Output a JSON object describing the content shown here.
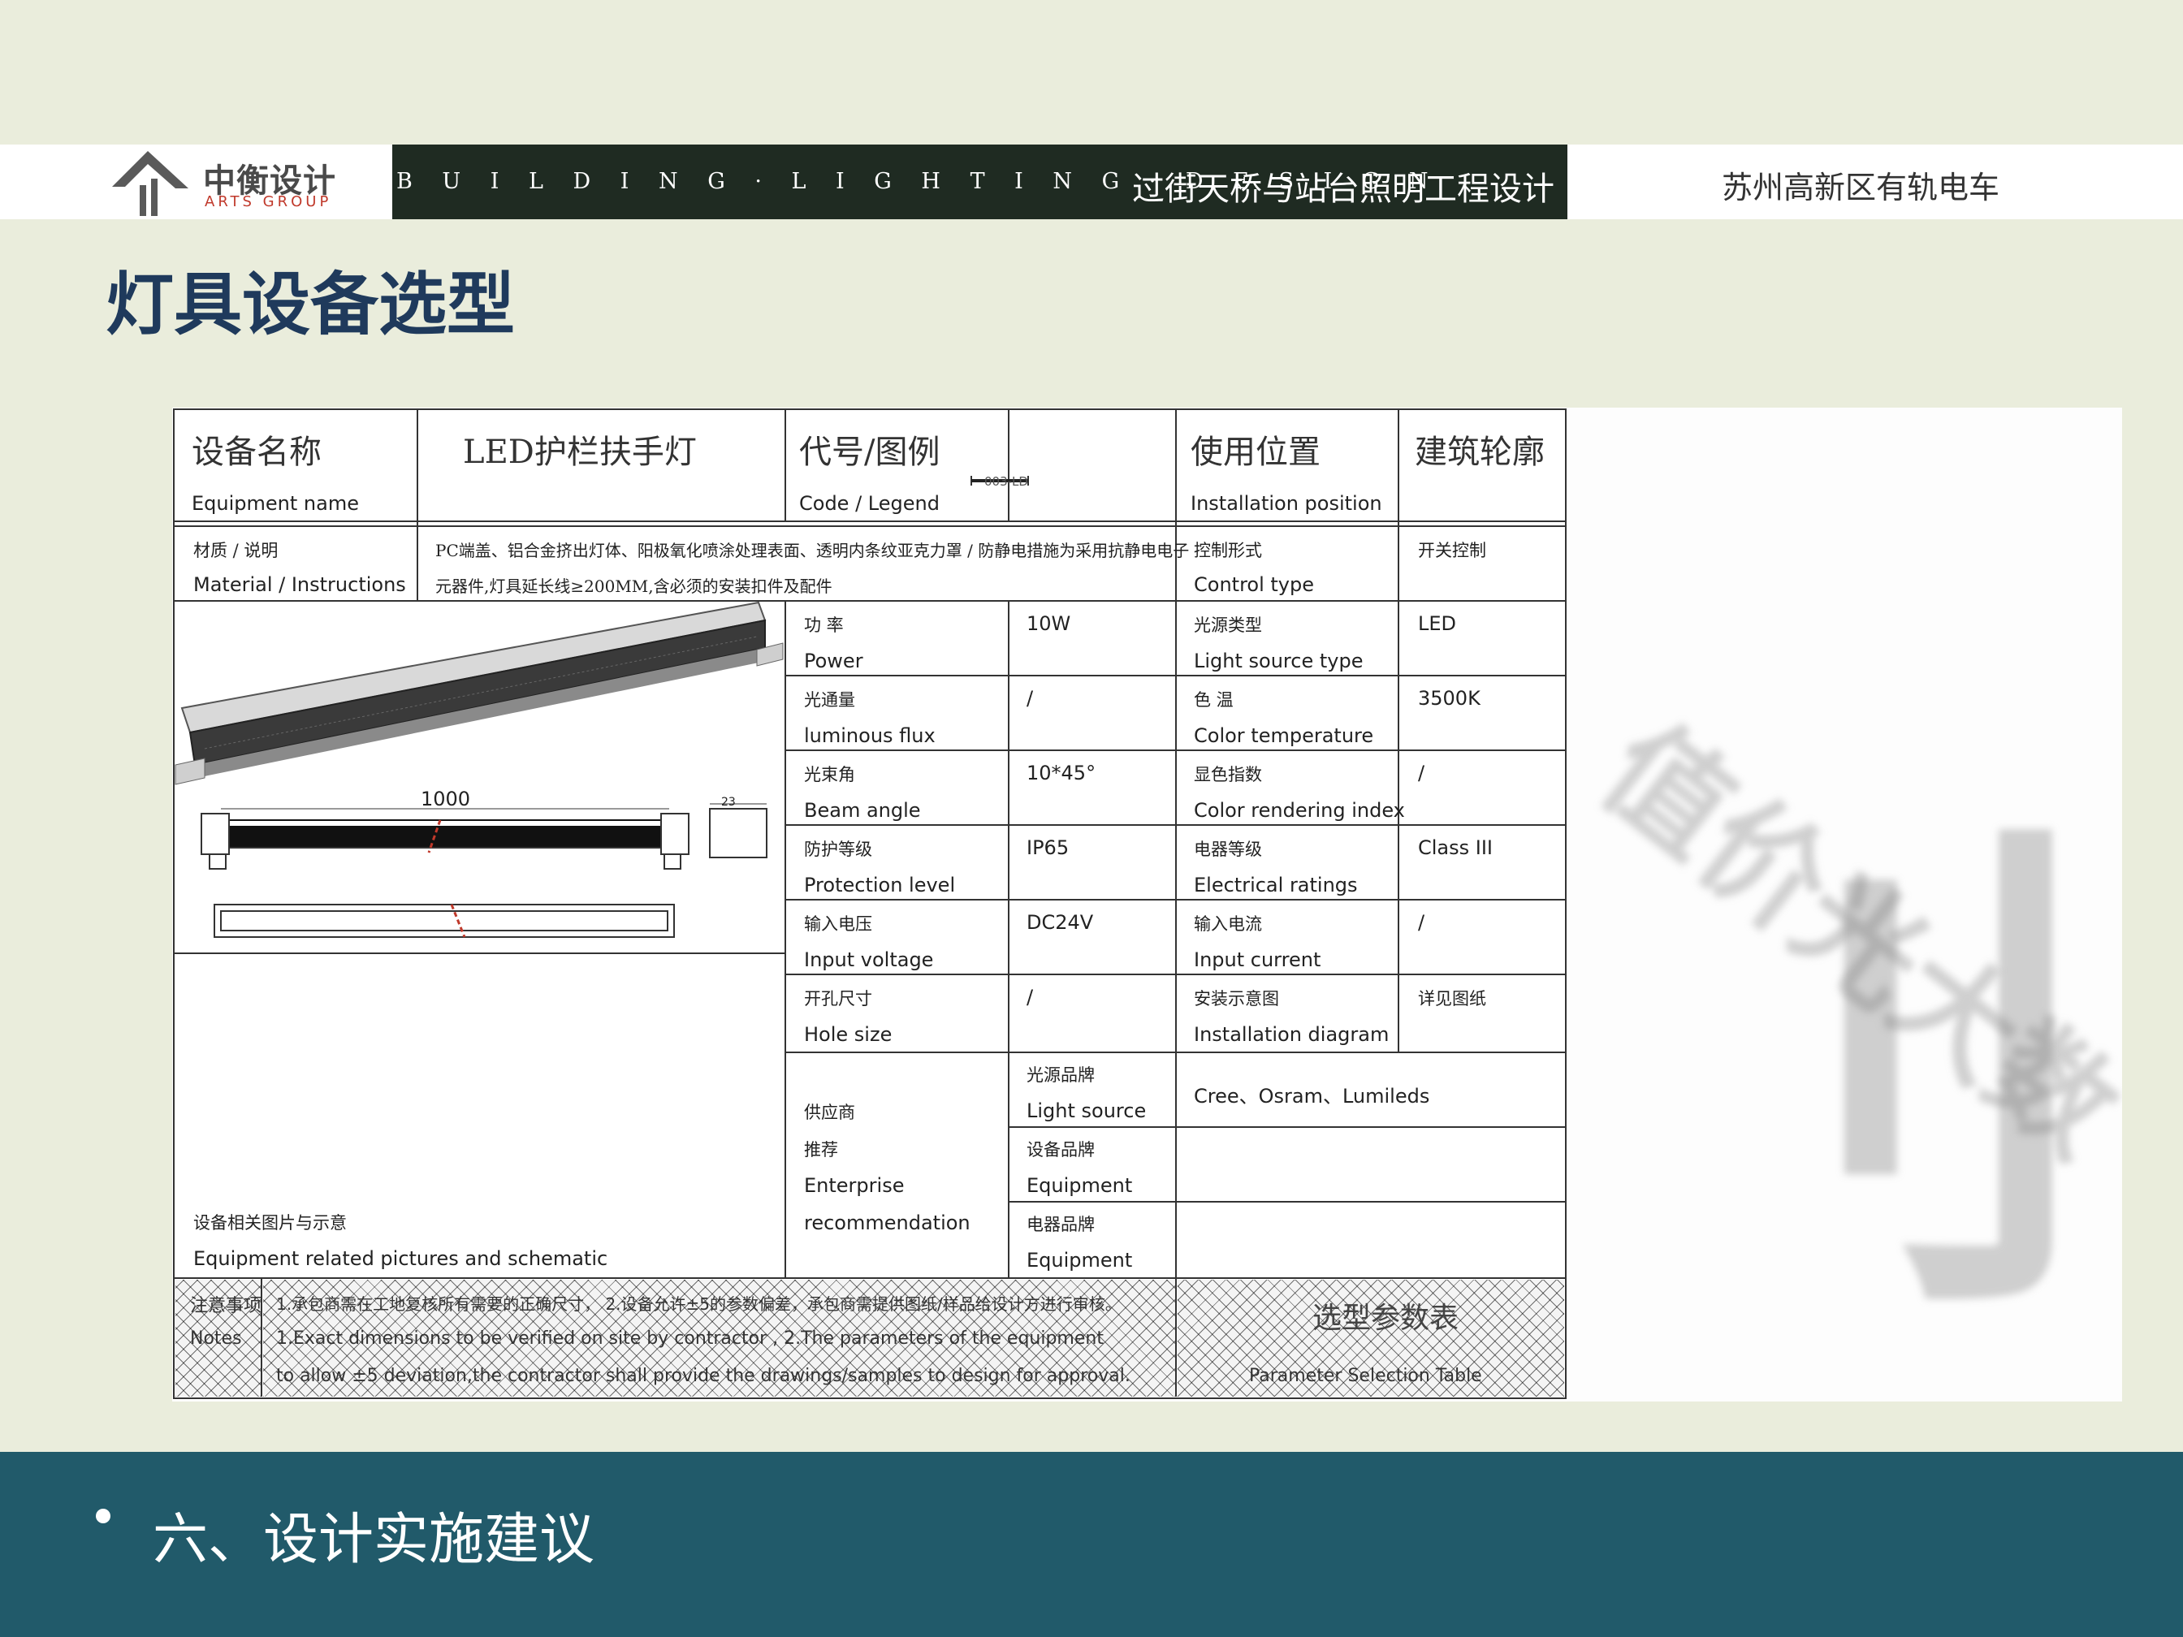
{
  "header": {
    "logo_cn": "中衡设计",
    "logo_en": "ARTS GROUP",
    "tagline": "B U I L D I N G · L I G H T I N G · D E S I G N",
    "project": "过街天桥与站台照明工程设计",
    "city": "苏州高新区有轨电车"
  },
  "page_title": "灯具设备选型",
  "sheet": {
    "equipment_name_cn": "设备名称",
    "equipment_name_en": "Equipment name",
    "equipment_name_value": "LED护栏扶手灯",
    "code_cn": "代号/图例",
    "code_en": "Code / Legend",
    "legend_code": "003-LD",
    "position_cn": "使用位置",
    "position_en": "Installation position",
    "profile_cn": "建筑轮廓",
    "material_cn": "材质 / 说明",
    "material_en": "Material / Instructions",
    "material_line1": "PC端盖、铝合金挤出灯体、阳极氧化喷涂处理表面、透明内条纹亚克力罩 / 防静电措施为采用抗静电电子",
    "material_line2": "元器件,灯具延长线≥200MM,含必须的安装扣件及配件",
    "control_cn": "控制形式",
    "control_en": "Control type",
    "control_value": "开关控制",
    "params": [
      {
        "cn": "功 率",
        "en": "Power",
        "value": "10W",
        "cn2": "光源类型",
        "en2": "Light source type",
        "value2": "LED"
      },
      {
        "cn": "光通量",
        "en": "luminous flux",
        "value": "/",
        "cn2": "色 温",
        "en2": "Color temperature",
        "value2": "3500K"
      },
      {
        "cn": "光束角",
        "en": "Beam angle",
        "value": "10*45°",
        "cn2": "显色指数",
        "en2": "Color rendering index",
        "value2": "/"
      },
      {
        "cn": "防护等级",
        "en": "Protection level",
        "value": "IP65",
        "cn2": "电器等级",
        "en2": "Electrical ratings",
        "value2": "Class III"
      },
      {
        "cn": "输入电压",
        "en": "Input voltage",
        "value": "DC24V",
        "cn2": "输入电流",
        "en2": "Input current",
        "value2": "/"
      },
      {
        "cn": "开孔尺寸",
        "en": "Hole size",
        "value": "/",
        "cn2": "安装示意图",
        "en2": "Installation diagram",
        "value2": "详见图纸"
      }
    ],
    "dim_length": "1000",
    "dim_height": "23",
    "supplier_cn1": "供应商",
    "supplier_cn2": "推荐",
    "supplier_en1": "Enterprise",
    "supplier_en2": "recommendation",
    "brand_light_cn": "光源品牌",
    "brand_light_en": "Light source",
    "brand_light_value": "Cree、Osram、Lumileds",
    "brand_equip_cn": "设备品牌",
    "brand_equip_en": "Equipment",
    "brand_elec_cn": "电器品牌",
    "brand_elec_en": "Equipment",
    "pictures_cn": "设备相关图片与示意",
    "pictures_en": "Equipment related pictures and schematic",
    "notes_cn": "注意事项",
    "notes_en": "Notes",
    "notes_line1": "1.承包商需在工地复核所有需要的正确尺寸， 2.设备允许±5的参数偏差，承包商需提供图纸/样品给设计方进行审核。",
    "notes_line2": "1.Exact dimensions to be verified on site by contractor , 2.The parameters of the equipment",
    "notes_line3": "to allow ±5 deviation,the contractor shall provide the drawings/samples to design for approval.",
    "table_name_cn": "选型参数表",
    "table_name_en": "Parameter Selection Table"
  },
  "watermark": {
    "text": "值价光大数",
    "glyph": "刂"
  },
  "footer": {
    "section": "六、设计实施建议"
  }
}
